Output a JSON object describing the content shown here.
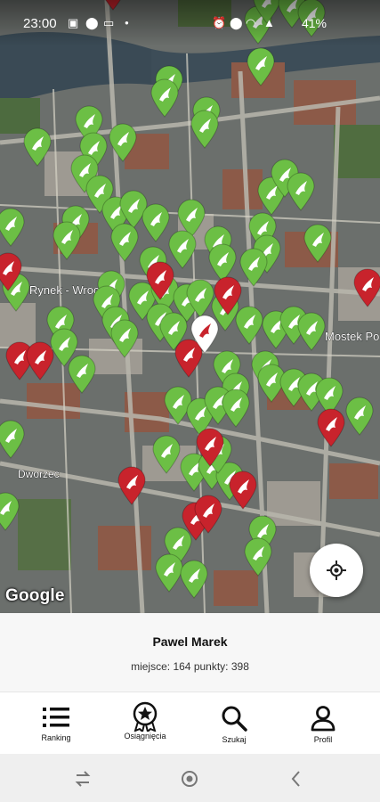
{
  "status_bar": {
    "time": "23:00",
    "battery": "41%",
    "icons_left": [
      "photo-icon",
      "location-icon",
      "battery-saver-icon",
      "dot-icon"
    ],
    "icons_right": [
      "alarm-icon",
      "location-icon",
      "wifi-icon",
      "signal-icon"
    ]
  },
  "map": {
    "attribution": "Google",
    "colors": {
      "visited_pin": "#6cbf45",
      "unvisited_pin": "#c8232c",
      "selected_pin": "#ffffff",
      "map_tone": "#5f6668"
    },
    "labels": [
      "Rynek - Wrocław",
      "Mostek Pokutnic",
      "Dworzec"
    ]
  },
  "user": {
    "name": "Pawel Marek",
    "place_label": "miejsce:",
    "place_value": "164",
    "points_label": "punkty:",
    "points_value": "398"
  },
  "nav": {
    "ranking": "Ranking",
    "achievements": "Osiągnięcia",
    "search": "Szukaj",
    "profile": "Profil"
  },
  "system_nav": [
    "recent-apps-icon",
    "home-icon",
    "back-icon"
  ]
}
